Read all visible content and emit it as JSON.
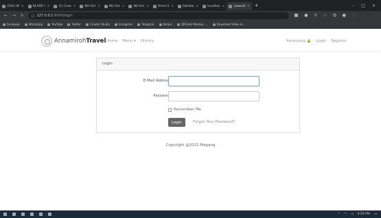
{
  "browser": {
    "tabs": [
      {
        "label": "(502) W"
      },
      {
        "label": "BLADE I"
      },
      {
        "label": "(1) Crea"
      },
      {
        "label": "NU Onl"
      },
      {
        "label": "NU Onl"
      },
      {
        "label": "NU Onl"
      },
      {
        "label": "Drive S"
      },
      {
        "label": "Databa"
      },
      {
        "label": "localhos"
      },
      {
        "label": "Laravel"
      }
    ],
    "url_host": "127.0.0.1",
    "url_path": ":8000/login",
    "bookmarks": [
      "Facebook",
      "WhatsApp",
      "YouTube",
      "Twitter",
      "Creator Studio",
      "Instagram",
      "Telegram",
      "Skripsi",
      "QRCode Monkey -...",
      "Download Video In..."
    ]
  },
  "navbar": {
    "brand_part1": "Annamiroh",
    "brand_part2": "Travel",
    "menu": [
      "Home",
      "Menu ▾",
      "History"
    ],
    "right": [
      "Keranjang 🔒",
      "Login",
      "Register"
    ]
  },
  "login_card": {
    "header": "Login",
    "email_label": "E-Mail Address",
    "password_label": "Password",
    "remember_label": "Remember Me",
    "login_button": "Login",
    "forgot_link": "Forgot Your Password?"
  },
  "footer": {
    "copyright": "Copyright @2021 Magang"
  },
  "taskbar": {
    "clock": "9:59 PM"
  }
}
